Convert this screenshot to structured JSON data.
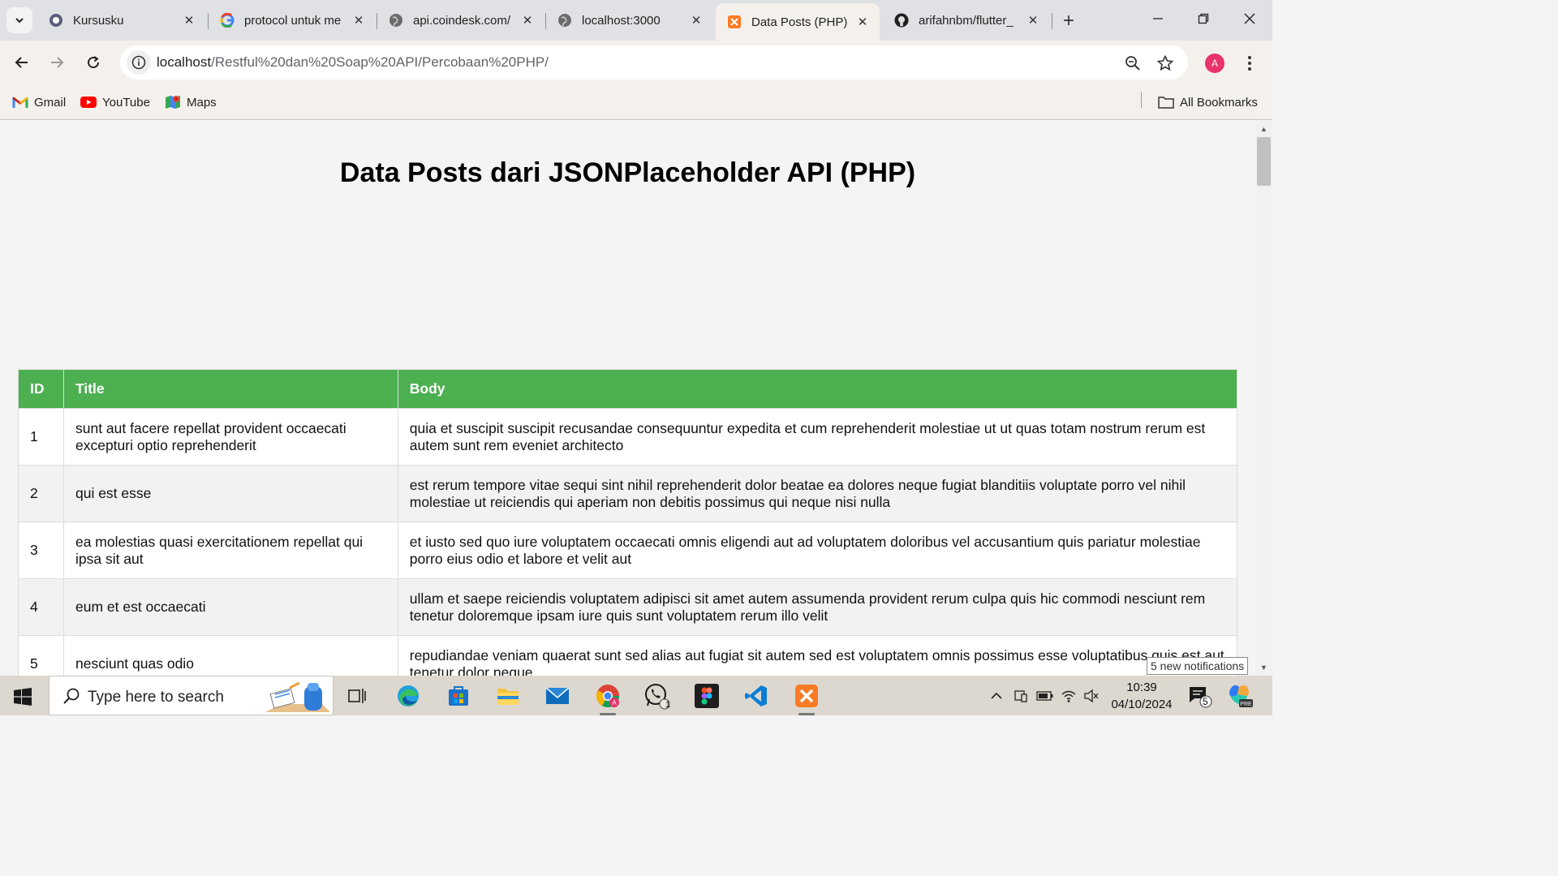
{
  "browser": {
    "tabs": [
      {
        "label": "Kursusku",
        "icon": "moodle-icon"
      },
      {
        "label": "protocol untuk me",
        "icon": "google-icon"
      },
      {
        "label": "api.coindesk.com/",
        "icon": "globe-icon"
      },
      {
        "label": "localhost:3000",
        "icon": "globe-icon"
      },
      {
        "label": "Data Posts (PHP)",
        "icon": "xampp-icon",
        "active": true
      },
      {
        "label": "arifahnbm/flutter_",
        "icon": "github-icon"
      }
    ],
    "url_host": "localhost",
    "url_path": "/Restful%20dan%20Soap%20API/Percobaan%20PHP/",
    "profile_initial": "A",
    "bookmarks": [
      {
        "label": "Gmail",
        "icon": "gmail-icon"
      },
      {
        "label": "YouTube",
        "icon": "youtube-icon"
      },
      {
        "label": "Maps",
        "icon": "maps-icon"
      }
    ],
    "all_bookmarks_label": "All Bookmarks"
  },
  "page": {
    "title": "Data Posts dari JSONPlaceholder API (PHP)",
    "table": {
      "headers": [
        "ID",
        "Title",
        "Body"
      ],
      "rows": [
        {
          "id": "1",
          "title": "sunt aut facere repellat provident occaecati excepturi optio reprehenderit",
          "body": "quia et suscipit suscipit recusandae consequuntur expedita et cum reprehenderit molestiae ut ut quas totam nostrum rerum est autem sunt rem eveniet architecto"
        },
        {
          "id": "2",
          "title": "qui est esse",
          "body": "est rerum tempore vitae sequi sint nihil reprehenderit dolor beatae ea dolores neque fugiat blanditiis voluptate porro vel nihil molestiae ut reiciendis qui aperiam non debitis possimus qui neque nisi nulla"
        },
        {
          "id": "3",
          "title": "ea molestias quasi exercitationem repellat qui ipsa sit aut",
          "body": "et iusto sed quo iure voluptatem occaecati omnis eligendi aut ad voluptatem doloribus vel accusantium quis pariatur molestiae porro eius odio et labore et velit aut"
        },
        {
          "id": "4",
          "title": "eum et est occaecati",
          "body": "ullam et saepe reiciendis voluptatem adipisci sit amet autem assumenda provident rerum culpa quis hic commodi nesciunt rem tenetur doloremque ipsam iure quis sunt voluptatem rerum illo velit"
        },
        {
          "id": "5",
          "title": "nesciunt quas odio",
          "body": "repudiandae veniam quaerat sunt sed alias aut fugiat sit autem sed est voluptatem omnis possimus esse voluptatibus quis est aut tenetur dolor neque"
        }
      ]
    },
    "header_color": "#4caf50"
  },
  "notification_toast": "5 new notifications",
  "taskbar": {
    "search_placeholder": "Type here to search",
    "time": "10:39",
    "date": "04/10/2024",
    "whatsapp_badge": "1",
    "notification_count": "5"
  }
}
